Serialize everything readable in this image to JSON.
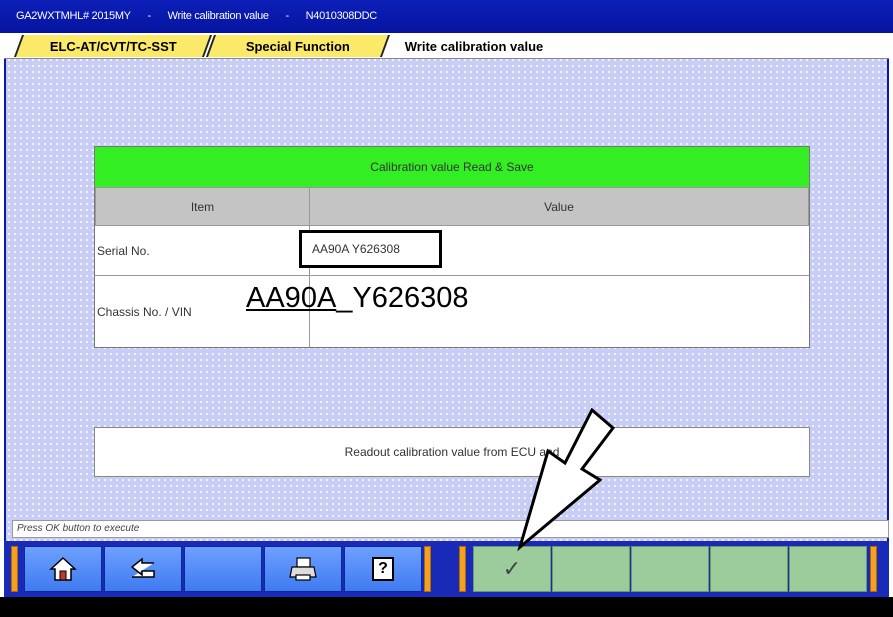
{
  "titlebar": {
    "model": "GA2WXTMHL# 2015MY",
    "sep1": "-",
    "screen": "Write calibration value",
    "sep2": "-",
    "part": "N4010308DDC"
  },
  "breadcrumb": {
    "tab1": "ELC-AT/CVT/TC-SST",
    "tab2": "Special Function",
    "current": "Write calibration value"
  },
  "calibration": {
    "header": "Calibration value Read & Save",
    "col_item": "Item",
    "col_value": "Value",
    "rows": [
      {
        "item": "Serial No.",
        "value": "AA90A Y626308"
      },
      {
        "item": "Chassis No. / VIN",
        "value": ""
      }
    ]
  },
  "annotation": {
    "vin_part1": "AA90A",
    "vin_part2": "_Y626308"
  },
  "message": "Readout calibration value from ECU and",
  "status": "Press OK button to execute",
  "toolbar": {
    "home": "home-icon",
    "back": "back-arrow-icon",
    "print": "printer-icon",
    "help": "?",
    "ok": "✓"
  },
  "colors": {
    "title_blue": "#0d1fb8",
    "header_green": "#33ee22",
    "crumb_yellow": "#fbe96a",
    "button_blue": "#4f86f5",
    "button_green": "#9ccc9c"
  }
}
